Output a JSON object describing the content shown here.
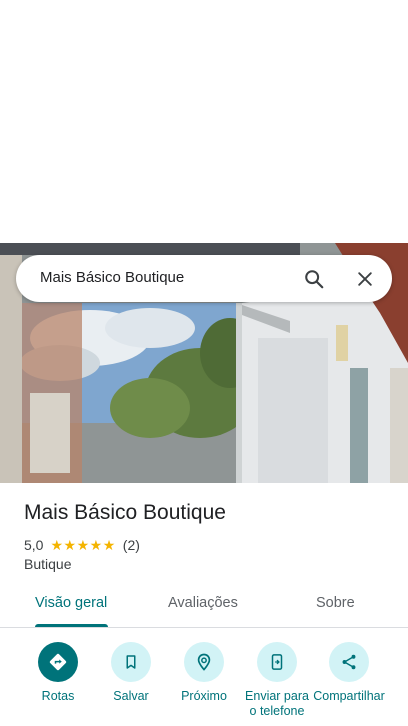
{
  "search": {
    "query": "Mais Básico Boutique"
  },
  "place": {
    "name": "Mais Básico Boutique",
    "rating": "5,0",
    "stars": 5,
    "review_count": "(2)",
    "category": "Butique"
  },
  "tabs": [
    {
      "label": "Visão geral",
      "active": true
    },
    {
      "label": "Avaliações",
      "active": false
    },
    {
      "label": "Sobre",
      "active": false
    }
  ],
  "actions": [
    {
      "label": "Rotas",
      "icon": "directions-icon"
    },
    {
      "label": "Salvar",
      "icon": "bookmark-icon"
    },
    {
      "label": "Próximo",
      "icon": "nearby-icon"
    },
    {
      "label": "Enviar para o telefone",
      "icon": "send-to-phone-icon"
    },
    {
      "label": "Compartilhar",
      "icon": "share-icon"
    }
  ],
  "colors": {
    "accent": "#00737a",
    "action_bg": "#d2f3f6",
    "star": "#f4b400"
  }
}
